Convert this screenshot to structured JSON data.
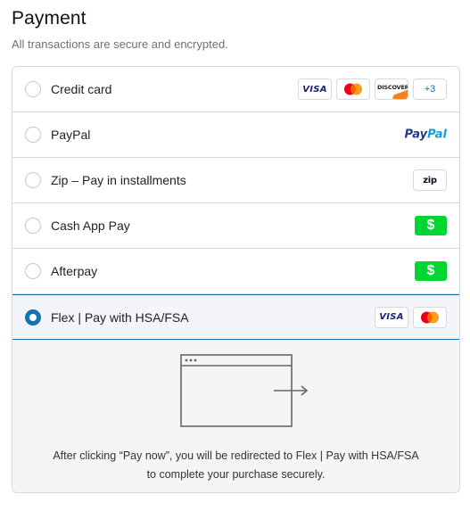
{
  "header": {
    "title": "Payment",
    "subtitle": "All transactions are secure and encrypted."
  },
  "methods": [
    {
      "label": "Credit card",
      "selected": false,
      "logos": [
        "visa-logo",
        "mastercard-logo",
        "discover-logo"
      ],
      "more": "+3"
    },
    {
      "label": "PayPal",
      "selected": false,
      "logos": [
        "paypal-logo"
      ]
    },
    {
      "label": "Zip – Pay in installments",
      "selected": false,
      "logos": [
        "zip-logo"
      ]
    },
    {
      "label": "Cash App Pay",
      "selected": false,
      "logos": [
        "cash-app-logo"
      ]
    },
    {
      "label": "Afterpay",
      "selected": false,
      "logos": [
        "cash-app-logo"
      ]
    },
    {
      "label": "Flex | Pay with HSA/FSA",
      "selected": true,
      "logos": [
        "visa-logo",
        "mastercard-logo"
      ]
    }
  ],
  "logo_text": {
    "visa": "VISA",
    "discover": "DISCOVER",
    "paypal_a": "Pay",
    "paypal_b": "Pal",
    "zip": "zip",
    "cash": "$"
  },
  "detail": {
    "message": "After clicking “Pay now”, you will be redirected to Flex | Pay with HSA/FSA to complete your purchase securely."
  },
  "colors": {
    "accent": "#1773b0",
    "cash_app_green": "#00d632",
    "visa_blue": "#1a1f71",
    "mastercard_red": "#eb001b",
    "mastercard_orange": "#f79e1b",
    "paypal_dark": "#253b80",
    "paypal_light": "#179bd7",
    "selected_bg": "#f3f5fb"
  }
}
